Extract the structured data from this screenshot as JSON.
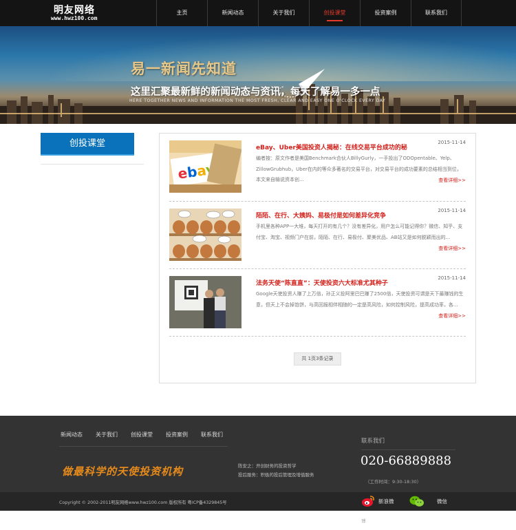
{
  "header": {
    "logo_name": "明友网络",
    "logo_url": "www.hwz100.com",
    "nav": [
      {
        "label": "主页",
        "active": false
      },
      {
        "label": "新闻动态",
        "active": false
      },
      {
        "label": "关于我们",
        "active": false
      },
      {
        "label": "创投课堂",
        "active": true
      },
      {
        "label": "投资案例",
        "active": false
      },
      {
        "label": "联系我们",
        "active": false
      }
    ]
  },
  "banner": {
    "title": "易一新闻先知道",
    "subtitle": "这里汇聚最新鲜的新闻动态与资讯，每天了解易一多一点",
    "english": "Here together news and information the most fresh, clear and easy one o'clock every day"
  },
  "sidebar": {
    "title": "创投课堂"
  },
  "articles": [
    {
      "title": "eBay、Uber美国投资人揭秘：在线交易平台成功的秘",
      "date": "2015-11-14",
      "body": "编者按：原文作者是美国Benchmark合伙人BillyGurly，一手投出了ODOpentable、Yelp、ZillowGrubhub，Uber在内的等众多著名的交易平台，对交易平台的成功要素的总结相当到位，本文来自输说资本创...",
      "more": "查看详细>>"
    },
    {
      "title": "陌陌、在行、大姨妈、易极付是如何差异化竞争",
      "date": "2015-11-14",
      "body": "手机里各种APP一大堆，每天打开的有几个？没有差异化，用户怎么可能记得你？微信、知乎、支付宝、淘宝、视频门户在前，陌陌、在行、易极付、聚美优品、AB站又是如何脱颖而出的...",
      "more": "查看详细>>"
    },
    {
      "title": "法务天使“陈直直”：天使投资六大标准尤其种子",
      "date": "2015-11-14",
      "body": "Google天使投资人赚了上万倍，孙正义投阿里巴巴赚了2500倍，天使投资可谓是天下最赚钱的生意，但天上不会掉馅饼，与高回报相伴相随的一定是高风险，如何控制风险，提高成功率，各...",
      "more": "查看详细>>"
    }
  ],
  "pager": "共 1页3条记录",
  "footer": {
    "nav": [
      "新闻动态",
      "关于我们",
      "创投课堂",
      "投资案例",
      "联系我们"
    ],
    "slogan": "做最科学的天使投资机构",
    "info1": "陈安之：开创财务的投资哲学",
    "info2": "投后服务：积极的投后管理及增值服务",
    "contact_label": "联系我们",
    "phone": "020-66889888",
    "work_time": "（工作时间：9:30-18:30）",
    "copyright": "Copyright © 2002-2011明友网络www.hwz100.com 版权所有 粤ICP备4329845号",
    "weibo": "新浪微",
    "weibo_extra": "博",
    "wechat": "微信"
  }
}
